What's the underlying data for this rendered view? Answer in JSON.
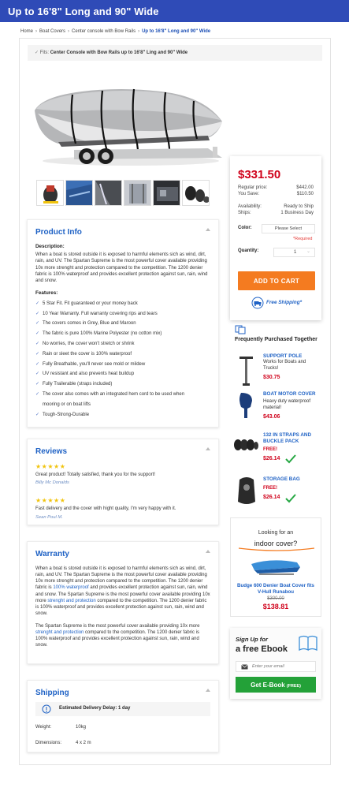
{
  "page": {
    "title": "Up to 16'8\" Long and 90\" Wide"
  },
  "breadcrumb": {
    "items": [
      "Home",
      "Boat Covers",
      "Center console with Bow Rails",
      "Up to 16'8\" Long and 90\" Wide"
    ],
    "separator": "›"
  },
  "fits": {
    "label": "Fits:",
    "value": "Center Console with Bow Rails up to 16'8\" Ling and 90\" Wide"
  },
  "product_info": {
    "title": "Product Info",
    "description_label": "Description:",
    "description": "When a boat is stored outside it is exposed to harmful elements sich as wind, dirt, rain, and UV. The Spartan Supreme is the most powerful cover available providing 10x more strenght and protection compared to the competition. The 1200 denier fabric is 100% waterproof and provides excellent protection against sun, rain, wind and snow.",
    "features_label": "Features:",
    "features": [
      "5 Star Fit. Fit guaranteed or your money back",
      "10 Year Warranty. Full warranty covering rips and tears",
      "The covers comes in Grey, Blue and Maroon",
      "The fabric is pure 100% Marine Polyester (no cotton mix)",
      "No worries, the cover won't stretch or shrink",
      "Rain or sleet the cover is 100% waterproof",
      "Fully Breathable, you'll never see mold or mildew",
      "UV resistant and also prevents heat buildup",
      "Fully Trailerable (straps included)",
      "The cover also comes with an integrated hem cord to be used when mooring or on boat lifts",
      "Tough-Strong-Durable"
    ]
  },
  "reviews": {
    "title": "Reviews",
    "items": [
      {
        "stars": "★★★★★",
        "rating": 5,
        "text": "Great product! Totally satisfied, thank you for the support!",
        "author": "Billy Mc Donalds"
      },
      {
        "stars": "★★★★★",
        "rating": 5,
        "text": "Fast delivery and the cover with hight quality, I'm very happy with it.",
        "author": "Sean Poul M."
      }
    ]
  },
  "warranty": {
    "title": "Warranty",
    "p1": {
      "a": "When a boat is stored outside it is exposed to harmful elements sich as wind, dirt, rain, and UV. The Spartan Supreme is the most powerful cover available providing 10x more strenght and protection compared to the competition. The 1200 denier fabric is ",
      "link1": "100% waterproof",
      "b": " and provides excellent protection against sun, rain, wind and snow. The Spartan Supreme is the most powerful cover available providing 10x more ",
      "link2": "strenght and protection",
      "c": " compared to the competition. The 1200 denier fabric is 100% waterproof and provides excellent protection against sun, rain, wind and snow."
    },
    "p2": {
      "a": "The Spartan Supreme is the most powerful cover available providing 10x more ",
      "link": "strenght and protection",
      "b": " compared to the competition. The 1200 denier fabric is 100% waterproof and provides excellent protection against sun, rain, wind and snow."
    }
  },
  "shipping": {
    "title": "Shipping",
    "delay": "Estimated Delivery Delay: 1 day",
    "rows": [
      {
        "label": "Weight:",
        "value": "10kg"
      },
      {
        "label": "Dimensions:",
        "value": "4 x 2 m"
      }
    ]
  },
  "buy_box": {
    "price": "$331.50",
    "regular_label": "Regular price:",
    "regular_value": "$442.00",
    "save_label": "You Save:",
    "save_value": "$110.50",
    "availability_label": "Availability:",
    "availability_value": "Ready to Ship",
    "ships_label": "Ships:",
    "ships_value": "1 Business Day",
    "color_label": "Color:",
    "color_value": "Please Select",
    "required": "*Required",
    "quantity_label": "Quantity:",
    "quantity_value": "1",
    "cart_button": "ADD TO CART",
    "free_shipping": "Free Shipping*"
  },
  "frequently_bought": {
    "title": "Frequently Purchased Together",
    "items": [
      {
        "name": "SUPPORT POLE",
        "desc": "Works for Boats and Trucks!",
        "price": "$30.75"
      },
      {
        "name": "BOAT MOTOR COVER",
        "desc": "Heavy duty waterproof material!",
        "price": "$43.06"
      },
      {
        "name": "132 IN STRAPS AND BUCKLE PACK",
        "free": "FREE!",
        "price": "$26.14"
      },
      {
        "name": "STORAGE BAG",
        "free": "FREE!",
        "price": "$26.14"
      }
    ]
  },
  "promo": {
    "line1": "Looking for an",
    "line2": "indoor cover?",
    "product": "Budge 600 Denier Boat Cover fits V-Hull Runabou",
    "old_price": "$300.00",
    "new_price": "$138.81"
  },
  "ebook": {
    "line1": "Sign Up for",
    "line2": "a free Ebook",
    "email_placeholder": "Enter your email",
    "button": "Get E-Book",
    "button_suffix": "(FREE)"
  },
  "colors": {
    "header": "#2f4bb7",
    "link": "#1f62c5",
    "price": "#d0021b",
    "cart": "#f47b20",
    "ebook": "#23a138",
    "stars": "#f1c40f"
  }
}
